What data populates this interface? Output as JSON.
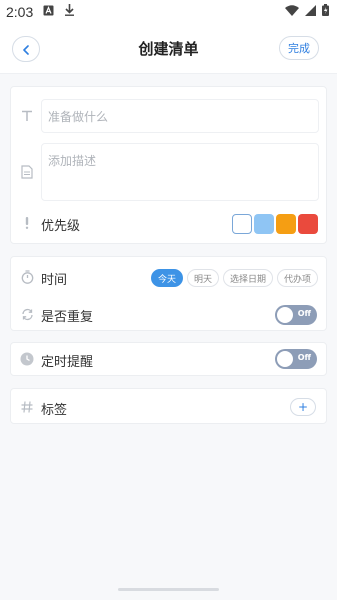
{
  "status_bar": {
    "time": "2:03"
  },
  "header": {
    "title": "创建清单",
    "done_label": "完成"
  },
  "form": {
    "title_placeholder": "准备做什么",
    "desc_placeholder": "添加描述",
    "priority_label": "优先级",
    "priority_colors": [
      "#ffffff",
      "#8fc5f4",
      "#f59e13",
      "#ea4a3d"
    ]
  },
  "time_section": {
    "time_label": "时间",
    "options": [
      "今天",
      "明天",
      "选择日期",
      "代办项"
    ],
    "selected_option": "今天",
    "repeat_label": "是否重复",
    "repeat_toggle": "Off"
  },
  "reminder_section": {
    "label": "定时提醒",
    "toggle": "Off"
  },
  "tag_section": {
    "label": "标签",
    "add_label": "+"
  }
}
